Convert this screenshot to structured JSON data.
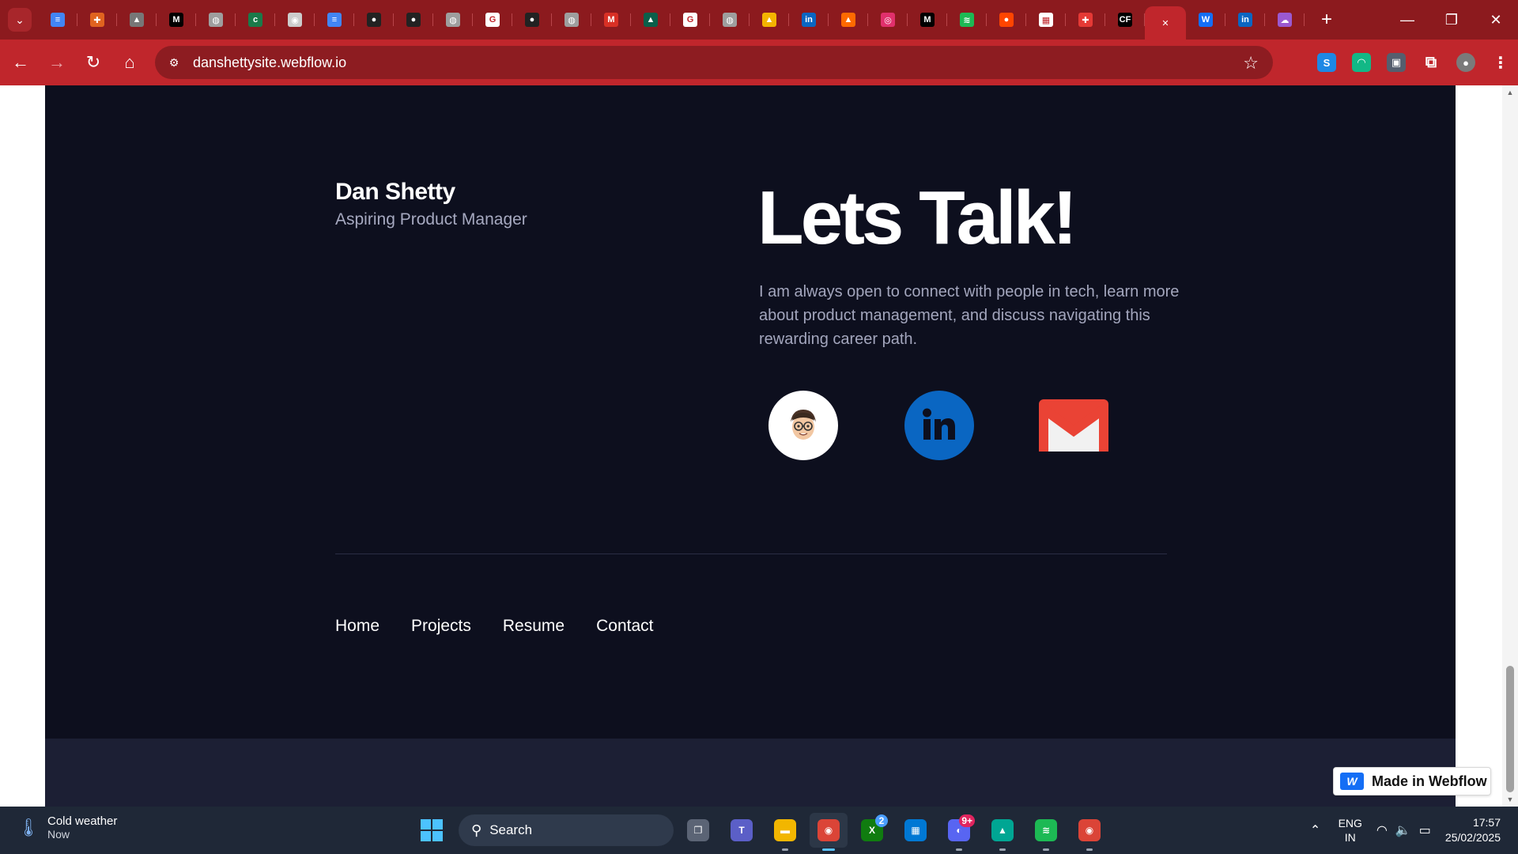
{
  "browser": {
    "tabs": [
      {
        "icon": "google-docs-icon",
        "glyph": "≡",
        "color": "#4285f4"
      },
      {
        "icon": "app-icon",
        "glyph": "✚",
        "color": "#e0631f"
      },
      {
        "icon": "profile-icon",
        "glyph": "▲",
        "color": "#777777"
      },
      {
        "icon": "medium-icon",
        "glyph": "M",
        "color": "#000000"
      },
      {
        "icon": "globe-icon",
        "glyph": "◍",
        "color": "#9e9e9e"
      },
      {
        "icon": "app-icon",
        "glyph": "c",
        "color": "#1a7a4a"
      },
      {
        "icon": "chrome-icon",
        "glyph": "◉",
        "color": "#cccccc"
      },
      {
        "icon": "google-docs-icon",
        "glyph": "≡",
        "color": "#4285f4"
      },
      {
        "icon": "github-icon",
        "glyph": "●",
        "color": "#222222"
      },
      {
        "icon": "github-icon",
        "glyph": "●",
        "color": "#222222"
      },
      {
        "icon": "globe-icon",
        "glyph": "◍",
        "color": "#9e9e9e"
      },
      {
        "icon": "google-icon",
        "glyph": "G",
        "color": "#ffffff"
      },
      {
        "icon": "github-icon",
        "glyph": "●",
        "color": "#222222"
      },
      {
        "icon": "globe-icon",
        "glyph": "◍",
        "color": "#9e9e9e"
      },
      {
        "icon": "gmail-icon",
        "glyph": "M",
        "color": "#d93025"
      },
      {
        "icon": "app-icon",
        "glyph": "▲",
        "color": "#0a5f4a"
      },
      {
        "icon": "google-icon",
        "glyph": "G",
        "color": "#ffffff"
      },
      {
        "icon": "globe-icon",
        "glyph": "◍",
        "color": "#9e9e9e"
      },
      {
        "icon": "google-drive-icon",
        "glyph": "▲",
        "color": "#f4b400"
      },
      {
        "icon": "linkedin-icon",
        "glyph": "in",
        "color": "#0a66c2"
      },
      {
        "icon": "app-icon",
        "glyph": "▲",
        "color": "#ff6a00"
      },
      {
        "icon": "instagram-icon",
        "glyph": "◎",
        "color": "#e1306c"
      },
      {
        "icon": "medium-icon",
        "glyph": "M",
        "color": "#000000"
      },
      {
        "icon": "spotify-icon",
        "glyph": "≋",
        "color": "#1db954"
      },
      {
        "icon": "reddit-icon",
        "glyph": "●",
        "color": "#ff4500"
      },
      {
        "icon": "sheet-icon",
        "glyph": "▦",
        "color": "#ffffff"
      },
      {
        "icon": "app-icon",
        "glyph": "✚",
        "color": "#e53935"
      },
      {
        "icon": "app-icon",
        "glyph": "CF",
        "color": "#000000"
      },
      {
        "icon": "close-icon",
        "glyph": "✕",
        "color": "#c0262c",
        "active": true
      },
      {
        "icon": "webflow-icon",
        "glyph": "W",
        "color": "#146ef5"
      },
      {
        "icon": "linkedin-icon",
        "glyph": "in",
        "color": "#0a66c2"
      },
      {
        "icon": "app-icon",
        "glyph": "☁",
        "color": "#9b59d0"
      }
    ],
    "url": "danshettysite.webflow.io",
    "window_controls": {
      "minimize": "—",
      "restore": "❐",
      "close": "✕"
    }
  },
  "page": {
    "brand_name": "Dan Shetty",
    "brand_role": "Aspiring Product Manager",
    "talk_title": "Lets Talk!",
    "talk_text": "I am always open to connect with people in tech, learn more about product management, and discuss navigating this rewarding career path.",
    "social": [
      {
        "name": "memoji-link",
        "icon": "memoji-icon"
      },
      {
        "name": "linkedin-link",
        "icon": "linkedin-icon"
      },
      {
        "name": "gmail-link",
        "icon": "gmail-icon"
      }
    ],
    "footer_nav": [
      "Home",
      "Projects",
      "Resume",
      "Contact"
    ],
    "webflow_badge": "Made in Webflow"
  },
  "taskbar": {
    "weather_title": "Cold weather",
    "weather_sub": "Now",
    "search_placeholder": "Search",
    "apps": [
      {
        "icon": "task-view-icon",
        "glyph": "❐",
        "color": "#5b6475"
      },
      {
        "icon": "teams-icon",
        "glyph": "T",
        "color": "#5b5fc7"
      },
      {
        "icon": "file-explorer-icon",
        "glyph": "▬",
        "color": "#f2b600",
        "running": true
      },
      {
        "icon": "chrome-icon",
        "glyph": "◉",
        "color": "#db4437",
        "running": true,
        "active": true
      },
      {
        "icon": "xbox-icon",
        "glyph": "X",
        "color": "#107c10",
        "badge": "2"
      },
      {
        "icon": "store-icon",
        "glyph": "▦",
        "color": "#0078d4"
      },
      {
        "icon": "discord-icon",
        "glyph": "◐",
        "color": "#5865f2",
        "running": true,
        "badge": "9+"
      },
      {
        "icon": "app-icon",
        "glyph": "▲",
        "color": "#00a693",
        "running": true
      },
      {
        "icon": "spotify-icon",
        "glyph": "≋",
        "color": "#1db954",
        "running": true
      },
      {
        "icon": "chrome-icon",
        "glyph": "◉",
        "color": "#db4437",
        "running": true
      }
    ],
    "lang_top": "ENG",
    "lang_bottom": "IN",
    "time": "17:57",
    "date": "25/02/2025"
  }
}
